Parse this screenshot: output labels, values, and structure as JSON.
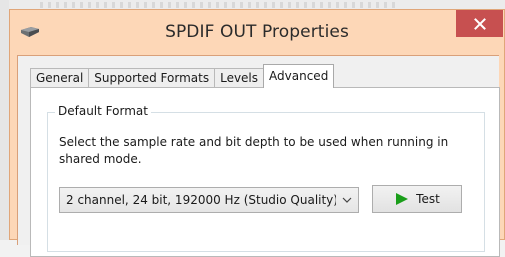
{
  "window": {
    "title": "SPDIF OUT Properties",
    "close_icon": "close-icon",
    "app_icon": "speaker-device-icon",
    "frame_color": "#fdd7b7",
    "close_color": "#c75050"
  },
  "tabs": [
    {
      "label": "General",
      "active": false
    },
    {
      "label": "Supported Formats",
      "active": false
    },
    {
      "label": "Levels",
      "active": false
    },
    {
      "label": "Advanced",
      "active": true
    }
  ],
  "default_format": {
    "legend": "Default Format",
    "description": "Select the sample rate and bit depth to be used when running in shared mode.",
    "selected_format": "2 channel, 24 bit, 192000 Hz (Studio Quality)",
    "test_button_label": "Test",
    "test_icon": "play-icon",
    "play_color": "#1a9e1a"
  }
}
